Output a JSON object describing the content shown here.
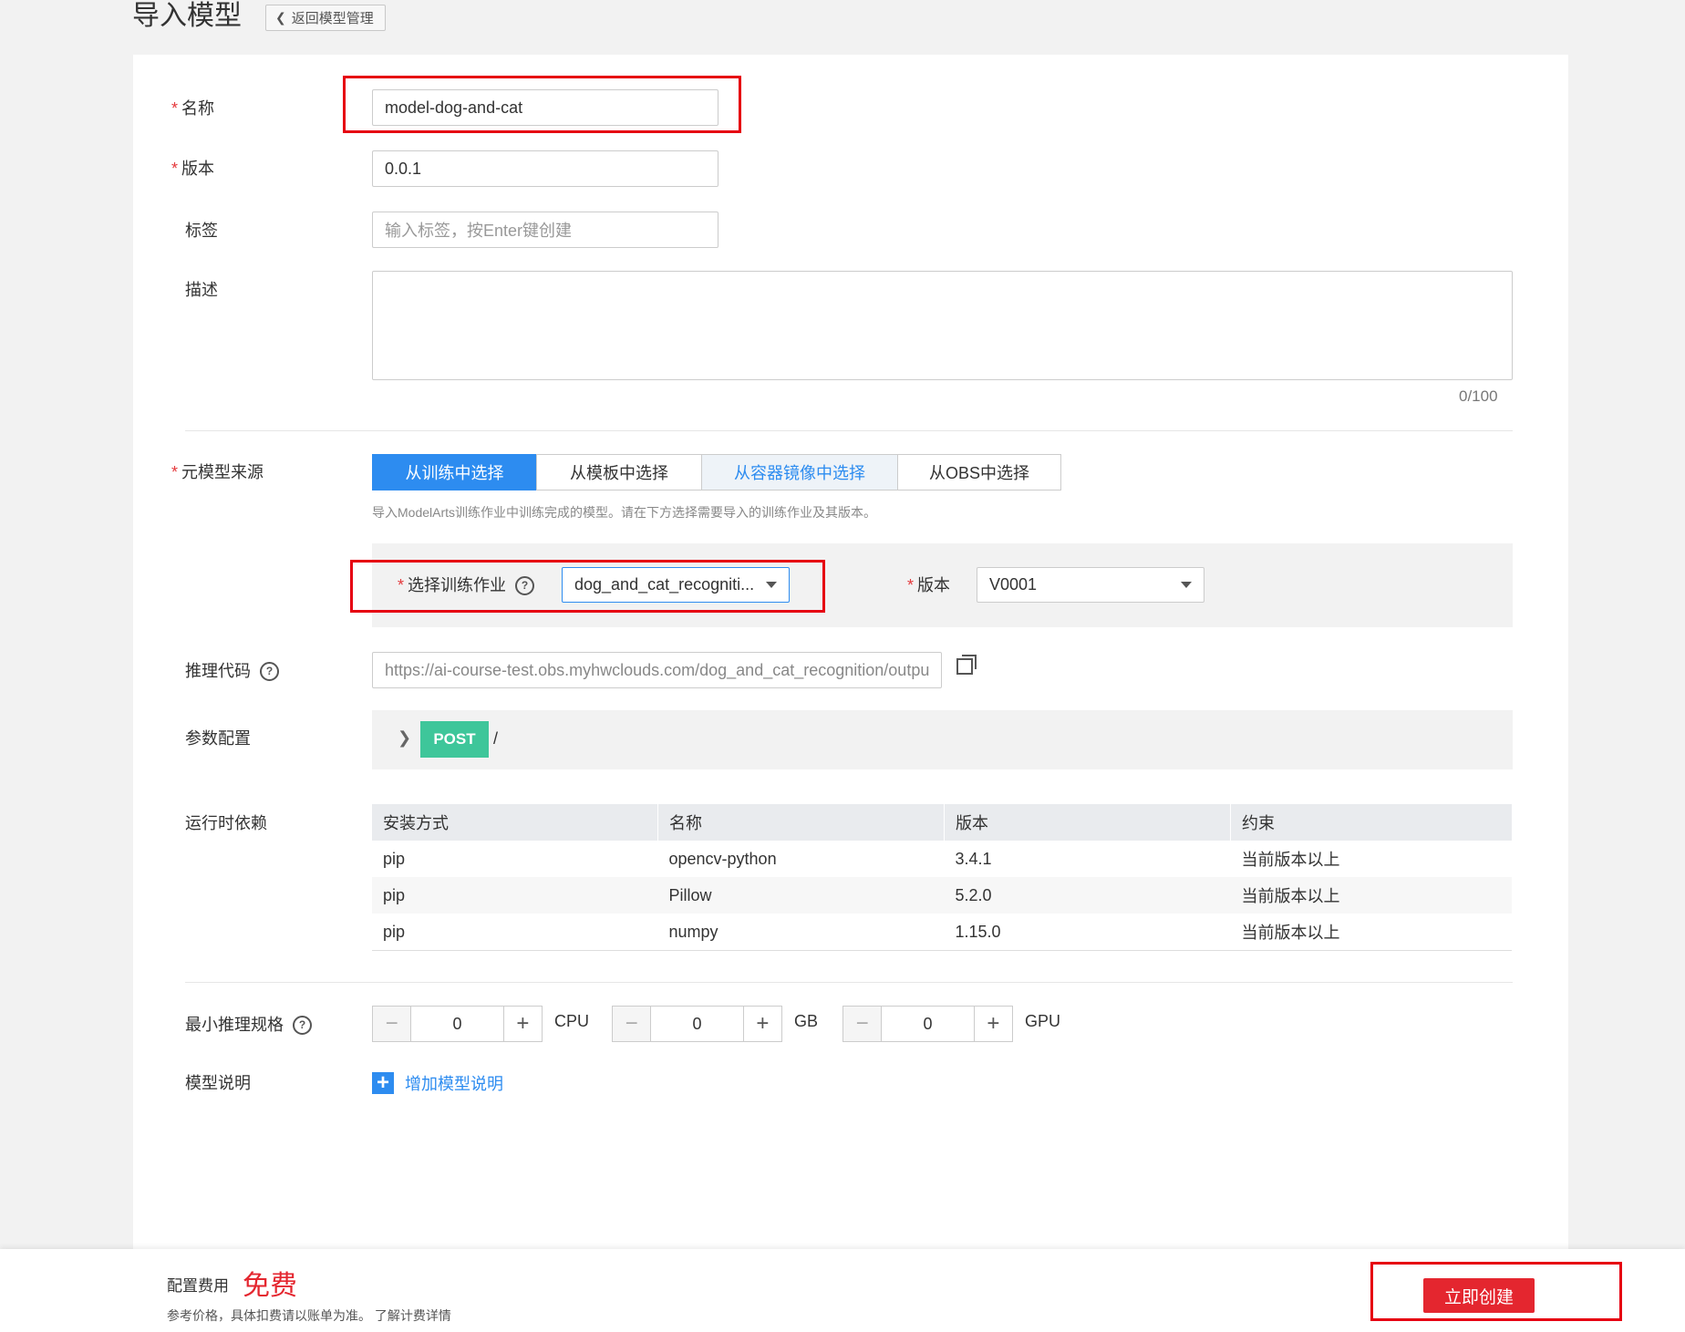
{
  "header": {
    "title": "导入模型",
    "back_label": "返回模型管理"
  },
  "form": {
    "name": {
      "label": "名称",
      "value": "model-dog-and-cat"
    },
    "version": {
      "label": "版本",
      "value": "0.0.1"
    },
    "tags": {
      "label": "标签",
      "placeholder": "输入标签，按Enter键创建"
    },
    "description": {
      "label": "描述",
      "value": "",
      "counter": "0/100"
    },
    "source": {
      "label": "元模型来源",
      "tabs": [
        "从训练中选择",
        "从模板中选择",
        "从容器镜像中选择",
        "从OBS中选择"
      ],
      "active_tab": 0,
      "hint": "导入ModelArts训练作业中训练完成的模型。请在下方选择需要导入的训练作业及其版本。",
      "job_label": "选择训练作业",
      "job_value": "dog_and_cat_recogniti...",
      "job_version_label": "版本",
      "job_version_value": "V0001"
    },
    "inference_code": {
      "label": "推理代码",
      "value": "https://ai-course-test.obs.myhwclouds.com/dog_and_cat_recognition/outpu"
    },
    "params": {
      "label": "参数配置",
      "method": "POST",
      "path": "/"
    },
    "runtime": {
      "label": "运行时依赖",
      "columns": [
        "安装方式",
        "名称",
        "版本",
        "约束"
      ],
      "rows": [
        [
          "pip",
          "opencv-python",
          "3.4.1",
          "当前版本以上"
        ],
        [
          "pip",
          "Pillow",
          "5.2.0",
          "当前版本以上"
        ],
        [
          "pip",
          "numpy",
          "1.15.0",
          "当前版本以上"
        ]
      ]
    },
    "min_spec": {
      "label": "最小推理规格",
      "cpu": {
        "value": "0",
        "unit": "CPU"
      },
      "gb": {
        "value": "0",
        "unit": "GB"
      },
      "gpu": {
        "value": "0",
        "unit": "GPU"
      }
    },
    "model_desc": {
      "label": "模型说明",
      "add_label": "增加模型说明"
    }
  },
  "footer": {
    "fee_label": "配置费用",
    "fee_value": "免费",
    "note": "参考价格，具体扣费请以账单为准。",
    "link": "了解计费详情",
    "create_label": "立即创建"
  },
  "colors": {
    "primary": "#2d8cf0",
    "danger": "#e4262f",
    "post": "#3ec69a",
    "highlight": "#e60012"
  }
}
